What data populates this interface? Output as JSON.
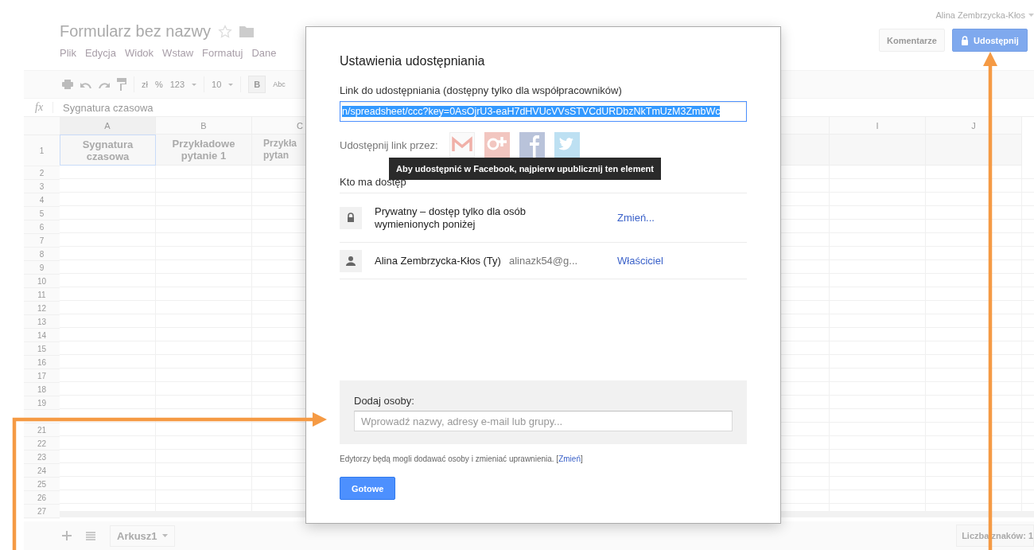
{
  "document": {
    "title": "Formularz bez nazwy",
    "menu": [
      "Plik",
      "Edycja",
      "Widok",
      "Wstaw",
      "Formatuj",
      "Dane"
    ]
  },
  "account": {
    "user": "Alina Zembrzycka-Kłos"
  },
  "header_buttons": [
    {
      "kind": "plain",
      "label": "Komentarze"
    },
    {
      "kind": "share",
      "label": "Udostępnij"
    }
  ],
  "toolbar": {
    "currency": "zł",
    "percent": "%",
    "number_format": "123",
    "font_size": "10",
    "bold": "B",
    "spellcheck": "Abc"
  },
  "formula_bar": {
    "icon": "fx",
    "value": "Sygnatura czasowa"
  },
  "sheet": {
    "columns_left": [
      "A",
      "B",
      "C"
    ],
    "columns_right": [
      "I",
      "J"
    ],
    "header_row": {
      "number": "1",
      "cells": [
        "Sygnatura czasowa",
        "Przykładowe pytanie 1",
        "Przykła pytan"
      ]
    },
    "row_numbers_upper": [
      "2",
      "3",
      "4",
      "5",
      "6",
      "7",
      "8",
      "9",
      "10",
      "11",
      "12",
      "13",
      "14",
      "15",
      "16",
      "17",
      "18",
      "19"
    ],
    "row_numbers_lower": [
      "21",
      "22",
      "23",
      "24",
      "25",
      "26",
      "27"
    ]
  },
  "bottom_bar": {
    "sheet_tab": "Arkusz1",
    "status": "Liczba znaków: 1"
  },
  "dialog": {
    "title": "Ustawienia udostępniania",
    "link_label": "Link do udostępniania (dostępny tylko dla współpracowników)",
    "link_value": "n/spreadsheet/ccc?key=0AsOjrU3-eaH7dHVUcVVsSTVCdURDbzNkTmUzM3ZmbWc",
    "share_via_label": "Udostępnij link przez:",
    "share_services": [
      {
        "kind": "gmail"
      },
      {
        "kind": "gplus"
      },
      {
        "kind": "facebook"
      },
      {
        "kind": "twitter"
      }
    ],
    "tooltip": "Aby udostępnić w Facebook, najpierw upublicznij ten element",
    "access_heading": "Kto ma dostęp",
    "access": [
      {
        "kind": "visibility",
        "name": "Prywatny – dostęp tylko dla osób wymienionych poniżej",
        "action": "Zmień..."
      },
      {
        "kind": "person",
        "name": "Alina Zembrzycka-Kłos (Ty)",
        "email": "alinazk54@g...",
        "action": "Właściciel"
      }
    ],
    "add_people": {
      "label": "Dodaj osoby:",
      "placeholder": "Wprowadź nazwy, adresy e-mail lub grupy..."
    },
    "note": {
      "text": "Edytorzy będą mogli dodawać osoby i zmieniać uprawnienia.",
      "prefix": "[",
      "link": "Zmień",
      "suffix": "]"
    },
    "done_button": "Gotowe"
  }
}
